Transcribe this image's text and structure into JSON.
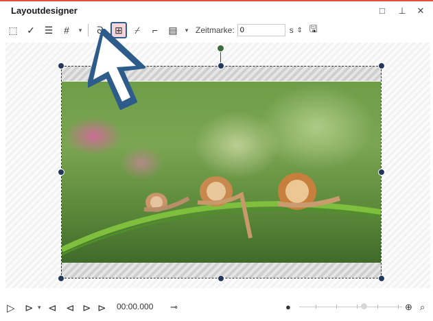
{
  "window": {
    "title": "Layoutdesigner",
    "maximize_glyph": "□",
    "pin_glyph": "⊥",
    "close_glyph": "✕"
  },
  "toolbar": {
    "timestamp_label": "Zeitmarke:",
    "timestamp_value": "0",
    "timestamp_unit": "s",
    "icons": [
      "select-icon",
      "check-icon",
      "layers-icon",
      "grid-icon",
      "curve-icon",
      "camera-frame-icon",
      "path-add-icon",
      "path-edit-icon",
      "template-icon",
      "save-icon"
    ]
  },
  "image": {
    "description_visible": "",
    "accent_selection": "#2d5c8a"
  },
  "playback": {
    "time": "00:00.000"
  },
  "colors": {
    "handle": "#23385a",
    "rotate_handle": "#3b6e3b",
    "title_accent": "#e0503c"
  }
}
